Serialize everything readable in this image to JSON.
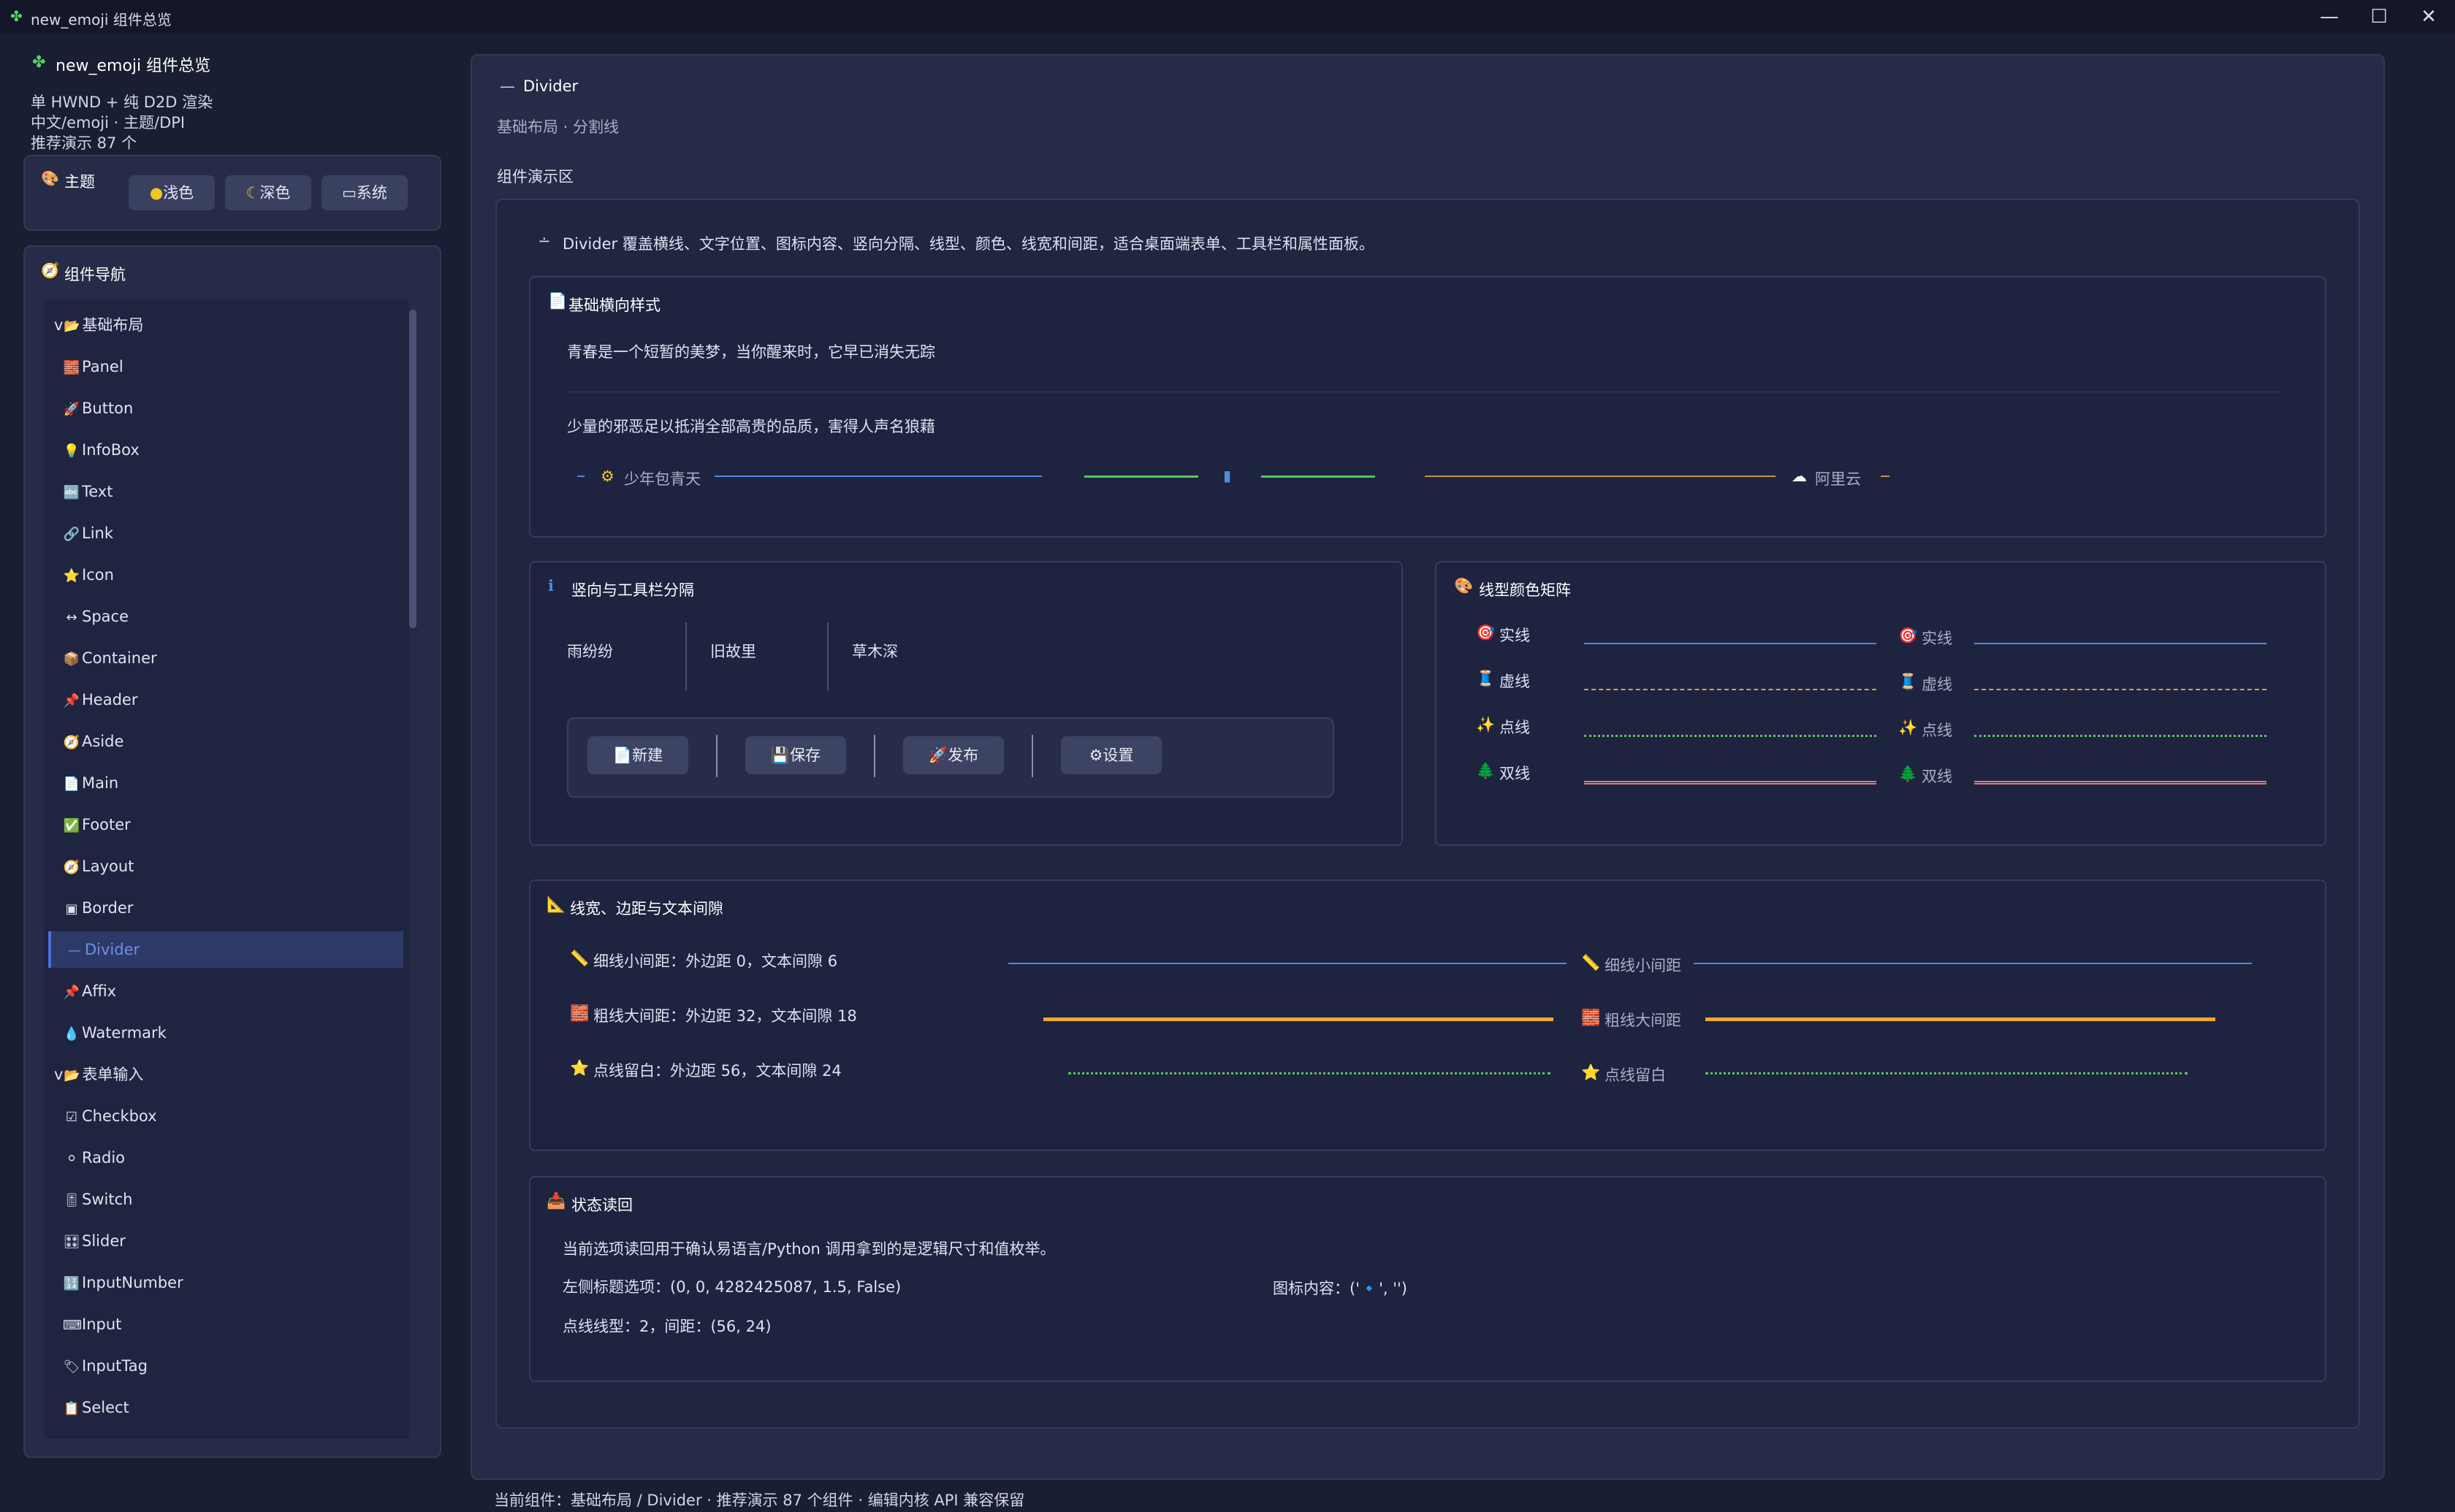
{
  "window": {
    "title": "new_emoji 组件总览",
    "minimize": "—",
    "maximize": "☐",
    "close": "✕"
  },
  "sidebar": {
    "app_title": "new_emoji 组件总览",
    "lines": [
      "单 HWND + 纯 D2D 渲染",
      "中文/emoji · 主题/DPI",
      "推荐演示 87 个"
    ],
    "theme": {
      "title": "主题",
      "options": [
        "浅色",
        "深色",
        "系统"
      ]
    },
    "nav": {
      "title": "组件导航",
      "items": [
        {
          "label": "基础布局",
          "icon": "📂",
          "group": true,
          "chevron": "v"
        },
        {
          "label": "Panel",
          "icon": "🧱"
        },
        {
          "label": "Button",
          "icon": "🚀"
        },
        {
          "label": "InfoBox",
          "icon": "💡"
        },
        {
          "label": "Text",
          "icon": "🔤"
        },
        {
          "label": "Link",
          "icon": "🔗"
        },
        {
          "label": "Icon",
          "icon": "⭐"
        },
        {
          "label": "Space",
          "icon": "↔"
        },
        {
          "label": "Container",
          "icon": "📦"
        },
        {
          "label": "Header",
          "icon": "📌"
        },
        {
          "label": "Aside",
          "icon": "🧭"
        },
        {
          "label": "Main",
          "icon": "📄"
        },
        {
          "label": "Footer",
          "icon": "✅"
        },
        {
          "label": "Layout",
          "icon": "🧭"
        },
        {
          "label": "Border",
          "icon": "▣"
        },
        {
          "label": "Divider",
          "icon": "—",
          "active": true
        },
        {
          "label": "Affix",
          "icon": "📌"
        },
        {
          "label": "Watermark",
          "icon": "💧"
        },
        {
          "label": "表单输入",
          "icon": "📂",
          "group": true,
          "chevron": "v"
        },
        {
          "label": "Checkbox",
          "icon": "☑"
        },
        {
          "label": "Radio",
          "icon": "⚪"
        },
        {
          "label": "Switch",
          "icon": "🎚"
        },
        {
          "label": "Slider",
          "icon": "🎛"
        },
        {
          "label": "InputNumber",
          "icon": "🔢"
        },
        {
          "label": "Input",
          "icon": "⌨"
        },
        {
          "label": "InputTag",
          "icon": "🏷"
        },
        {
          "label": "Select",
          "icon": "📋"
        }
      ]
    }
  },
  "main": {
    "header_title": "Divider",
    "header_sub": "基础布局 · 分割线",
    "demo_label": "组件演示区",
    "intro": "Divider 覆盖横线、文字位置、图标内容、竖向分隔、线型、颜色、线宽和间距，适合桌面端表单、工具栏和属性面板。",
    "basic": {
      "title": "基础横向样式",
      "line1": "青春是一个短暂的美梦，当你醒来时，它早已消失无踪",
      "line2": "少量的邪恶足以抵消全部高贵的品质，害得人声名狼藉",
      "text_divider": "少年包青天",
      "cloud_divider": "阿里云"
    },
    "vertical": {
      "title": "竖向与工具栏分隔",
      "words": [
        "雨纷纷",
        "旧故里",
        "草木深"
      ],
      "buttons": [
        {
          "label": "新建",
          "icon": "📄"
        },
        {
          "label": "保存",
          "icon": "💾"
        },
        {
          "label": "发布",
          "icon": "🚀"
        },
        {
          "label": "设置",
          "icon": "⚙"
        }
      ]
    },
    "matrix": {
      "title": "线型颜色矩阵",
      "rows": [
        {
          "label": "实线",
          "icon": "🎯",
          "style": "solid",
          "color": "#4f8be0"
        },
        {
          "label": "虚线",
          "icon": "🧵",
          "style": "dashed",
          "color": "#e0a13a"
        },
        {
          "label": "点线",
          "icon": "✨",
          "style": "dotted",
          "color": "#58c45c"
        },
        {
          "label": "双线",
          "icon": "🌲",
          "style": "double",
          "color": "#e07a7a"
        }
      ]
    },
    "widths": {
      "title": "线宽、边距与文本间隙",
      "rows": [
        {
          "label": "细线小间距：外边距 0，文本间隙 6",
          "icon": "📏",
          "right_label": "细线小间距",
          "color": "#4f8be0"
        },
        {
          "label": "粗线大间距：外边距 32，文本间隙 18",
          "icon": "🧱",
          "right_label": "粗线大间距",
          "color": "#f0a830"
        },
        {
          "label": "点线留白：外边距 56，文本间隙 24",
          "icon": "⭐",
          "right_label": "点线留白",
          "color": "#58c45c"
        }
      ]
    },
    "status": {
      "title": "状态读回",
      "line1": "当前选项读回用于确认易语言/Python 调用拿到的是逻辑尺寸和值枚举。",
      "line2": "左侧标题选项：(0, 0, 4282425087, 1.5, False)",
      "line2_right": "图标内容：('🔹', '')",
      "line3": "点线线型：2，间距：(56, 24)"
    }
  },
  "statusbar": "当前组件：基础布局 / Divider · 推荐演示 87 个组件 · 编辑内核 API 兼容保留"
}
